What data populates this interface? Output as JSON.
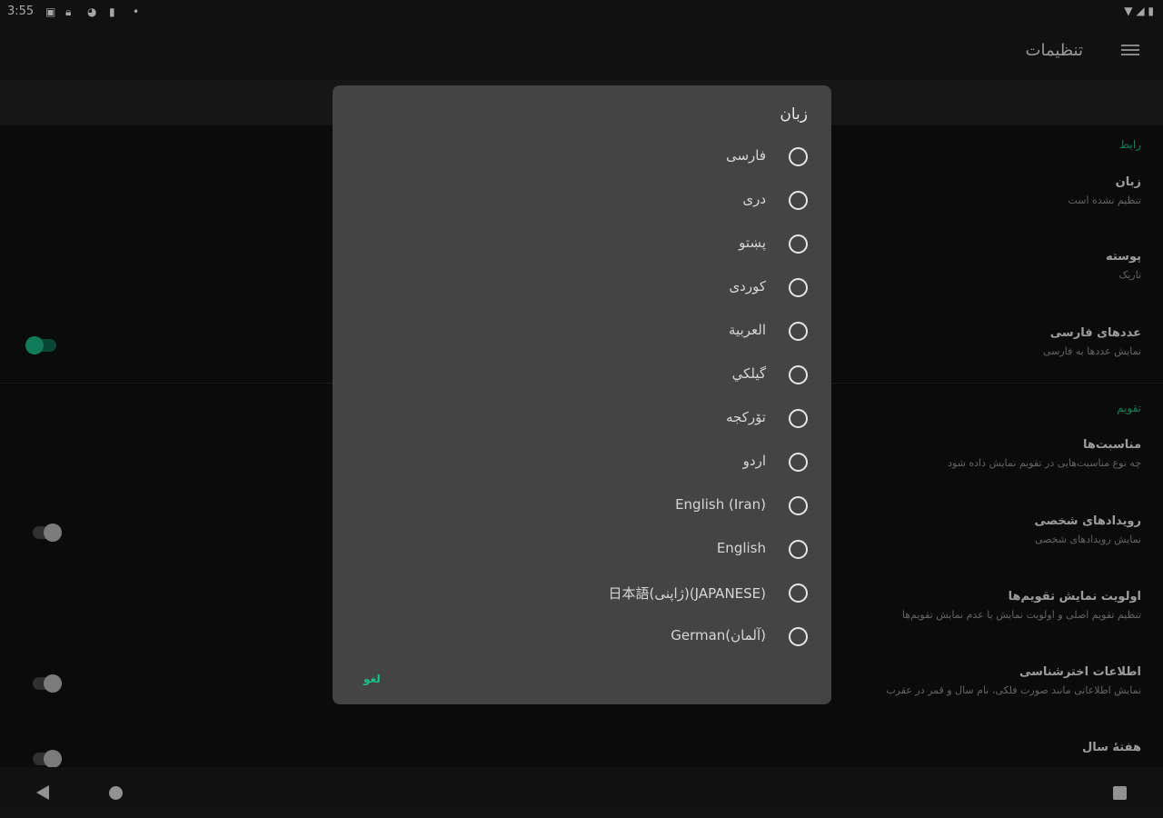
{
  "status_bar": {
    "time": "3:55",
    "icons_left": [
      "document-icon",
      "lock-icon",
      "globe-icon",
      "sd-card-icon",
      "dot-icon"
    ],
    "icons_right": [
      "wifi-icon",
      "signal-icon",
      "battery-icon"
    ]
  },
  "toolbar": {
    "title": "تنظیمات",
    "menu_icon": "menu-icon"
  },
  "settings": {
    "sections": [
      {
        "category": "رابط",
        "items": [
          {
            "title": "زبان",
            "subtitle": "تنظیم نشده است",
            "toggle": null
          },
          {
            "title": "پوسته",
            "subtitle": "تاریک",
            "toggle": null
          },
          {
            "title": "عددهای فارسی",
            "subtitle": "نمایش عددها به فارسی",
            "toggle": true
          }
        ]
      },
      {
        "category": "تقویم",
        "items": [
          {
            "title": "مناسبت‌ها",
            "subtitle": "چه نوع مناسبت‌هایی در تقویم نمایش داده شود",
            "toggle": null
          },
          {
            "title": "رویدادهای شخصی",
            "subtitle": "نمایش رویدادهای شخصی",
            "toggle": false
          },
          {
            "title": "اولویت نمایش تقویم‌ها",
            "subtitle": "تنظیم تقویم اصلی و اولویت نمایش یا عدم نمایش تقویم‌ها",
            "toggle": null
          },
          {
            "title": "اطلاعات اخترشناسی",
            "subtitle": "نمایش اطلاعاتی مانند صورت فلکی، نام سال و قمر در عقرب",
            "toggle": false
          },
          {
            "title": "هفتهٔ سال",
            "subtitle": "",
            "toggle": false
          }
        ]
      }
    ]
  },
  "dialog": {
    "title": "زبان",
    "options": [
      "فارسی",
      "دری",
      "پښتو",
      "کوردی",
      "العربية",
      "گیلکي",
      "تۆرکجه",
      "اردو",
      "English (Iran)",
      "English",
      "日本語(ژاپنی)(JAPANESE)",
      "German(آلمان)"
    ],
    "cancel_label": "لغو"
  },
  "colors": {
    "accent": "#1dbf8a",
    "dialog_bg": "#444444",
    "toolbar_bg": "#1b1b1b"
  }
}
